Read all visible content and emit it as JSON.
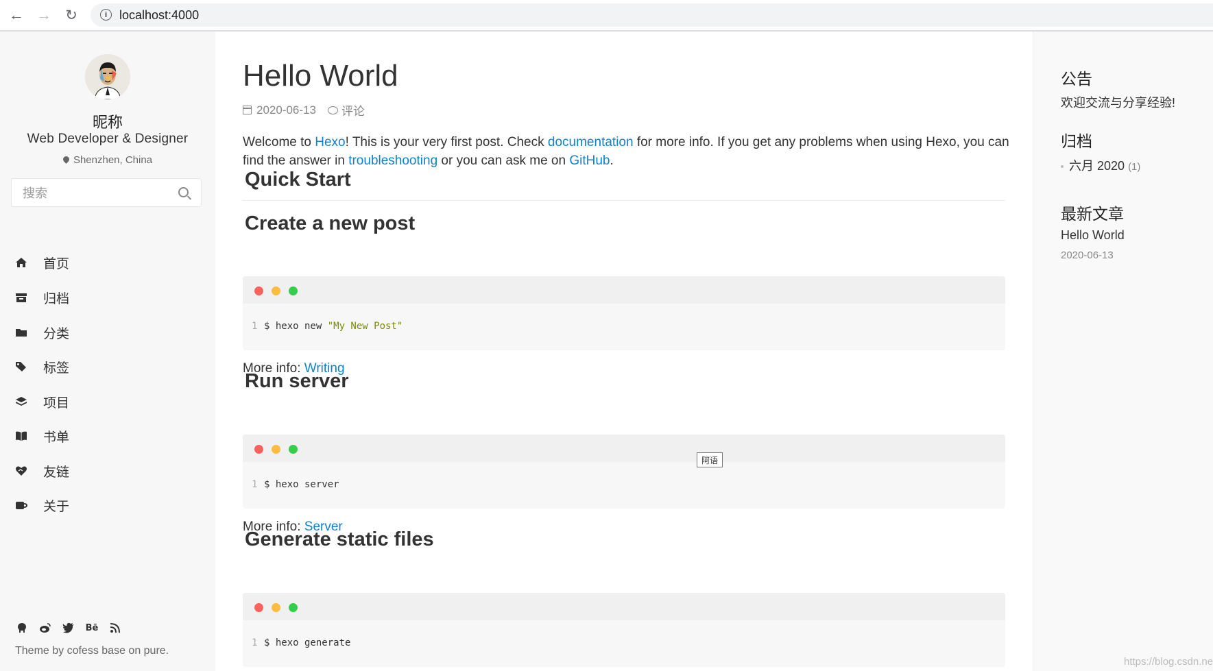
{
  "browser": {
    "url": "localhost:4000"
  },
  "sidebar": {
    "nickname": "昵称",
    "role": "Web Developer & Designer",
    "location": "Shenzhen, China",
    "search_placeholder": "搜索",
    "menu": [
      {
        "label": "首页",
        "icon": "home-icon"
      },
      {
        "label": "归档",
        "icon": "archive-icon"
      },
      {
        "label": "分类",
        "icon": "folder-icon"
      },
      {
        "label": "标签",
        "icon": "tags-icon"
      },
      {
        "label": "项目",
        "icon": "layers-icon"
      },
      {
        "label": "书单",
        "icon": "book-icon"
      },
      {
        "label": "友链",
        "icon": "heart-handshake-icon"
      },
      {
        "label": "关于",
        "icon": "coffee-icon"
      }
    ],
    "social_icons": [
      "github-icon",
      "weibo-icon",
      "twitter-icon",
      "behance-icon",
      "rss-icon"
    ],
    "behance_text": "Bē",
    "theme_credit": "Theme by cofess base on pure."
  },
  "post": {
    "title": "Hello World",
    "date": "2020-06-13",
    "comments_label": "评论",
    "intro": {
      "p1": "Welcome to ",
      "link1": "Hexo",
      "p2": "! This is your very first post. Check ",
      "link2": "documentation",
      "p3": " for more info. If you get any problems when using Hexo, you can find the answer in ",
      "link3": "troubleshooting",
      "p4": " or you can ask me on ",
      "link4": "GitHub",
      "p5": "."
    },
    "sections": {
      "quick_start": "Quick Start",
      "create_post": "Create a new post",
      "run_server": "Run server",
      "generate": "Generate static files"
    },
    "code": {
      "line_number": "1",
      "create_cmd": "$ hexo new ",
      "create_arg": "\"My New Post\"",
      "server_cmd": "$ hexo server",
      "generate_cmd": "$ hexo generate"
    },
    "more_info_label": "More info: ",
    "more_info_links": {
      "writing": "Writing",
      "server": "Server"
    },
    "tooltip": "阿语"
  },
  "aside": {
    "notice_title": "公告",
    "notice_text": "欢迎交流与分享经验!",
    "archive_title": "归档",
    "archive_month": "六月 2020",
    "archive_count": "(1)",
    "recent_title": "最新文章",
    "recent_post_title": "Hello World",
    "recent_post_date": "2020-06-13"
  },
  "watermark": "https://blog.csdn.ne",
  "colors": {
    "link": "#0e83cd",
    "dot_red": "#fc625d",
    "dot_yellow": "#fdbc40",
    "dot_green": "#35cd4b"
  }
}
